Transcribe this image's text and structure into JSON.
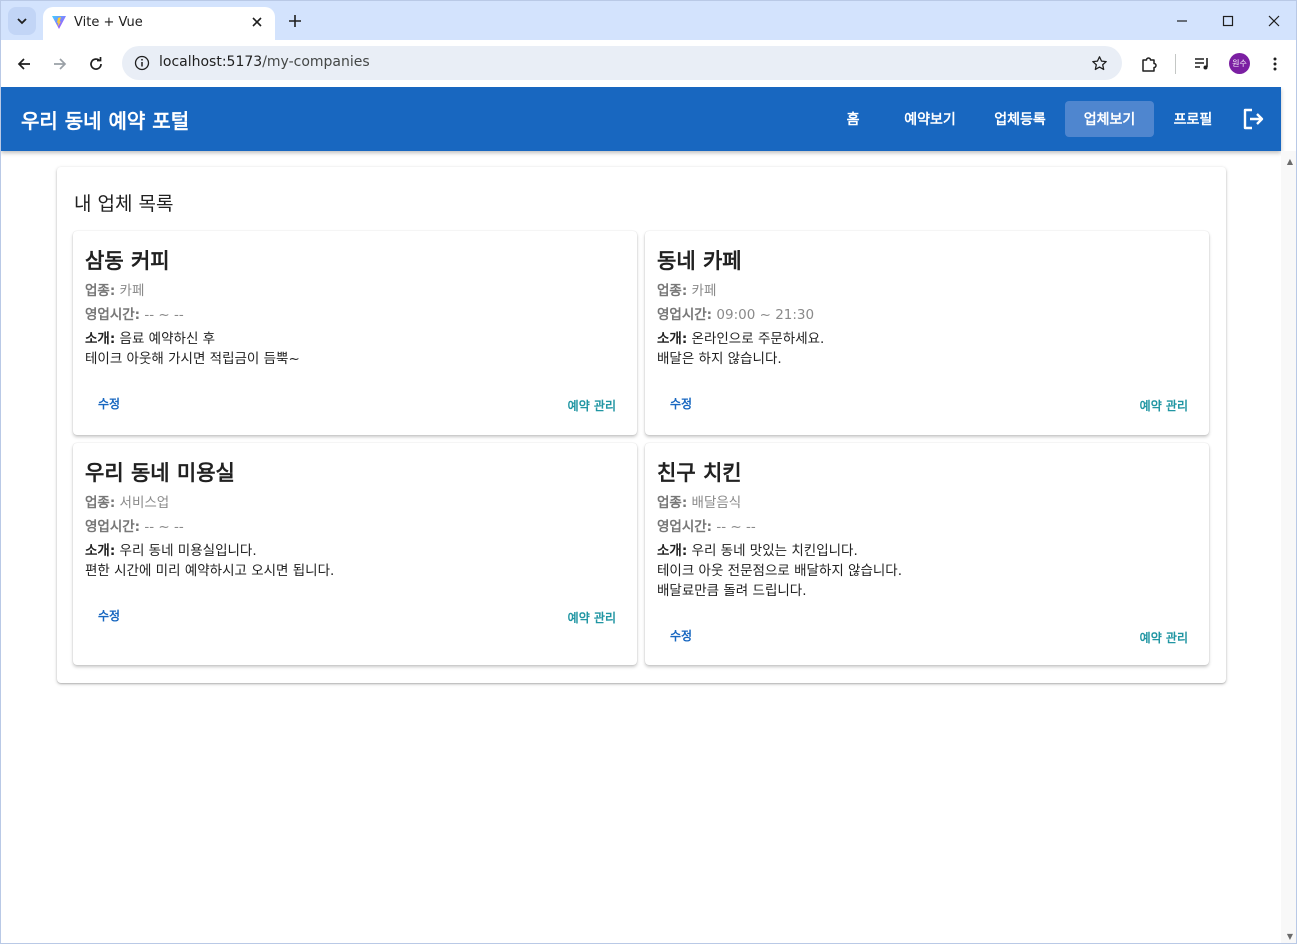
{
  "browser": {
    "tab_title": "Vite + Vue",
    "url_host": "localhost:5173",
    "url_path": "/my-companies",
    "profile_initials": "원수"
  },
  "app": {
    "title": "우리 동네 예약 포털",
    "nav": [
      {
        "label": "홈",
        "active": false
      },
      {
        "label": "예약보기",
        "active": false
      },
      {
        "label": "업체등록",
        "active": false
      },
      {
        "label": "업체보기",
        "active": true
      },
      {
        "label": "프로필",
        "active": false
      }
    ],
    "primary_color": "#1867c0"
  },
  "main": {
    "title": "내 업체 목록",
    "labels": {
      "category": "업종:",
      "hours": "영업시간:",
      "intro": "소개:",
      "edit": "수정",
      "manage": "예약 관리"
    },
    "companies": [
      {
        "name": "삼동 커피",
        "category": "카페",
        "hours": "-- ~ --",
        "intro": [
          "음료 예약하신 후",
          "테이크 아웃해 가시면 적립금이 듬뿍~"
        ]
      },
      {
        "name": "동네 카페",
        "category": "카페",
        "hours": "09:00 ~ 21:30",
        "intro": [
          "온라인으로 주문하세요.",
          "배달은 하지 않습니다."
        ]
      },
      {
        "name": "우리 동네 미용실",
        "category": "서비스업",
        "hours": "-- ~ --",
        "intro": [
          "우리 동네 미용실입니다.",
          "편한 시간에 미리 예약하시고 오시면 됩니다."
        ]
      },
      {
        "name": "친구 치킨",
        "category": "배달음식",
        "hours": "-- ~ --",
        "intro": [
          "우리 동네 맛있는 치킨입니다.",
          "테이크 아웃 전문점으로 배달하지 않습니다.",
          "배달료만큼 돌려 드립니다."
        ]
      }
    ]
  }
}
